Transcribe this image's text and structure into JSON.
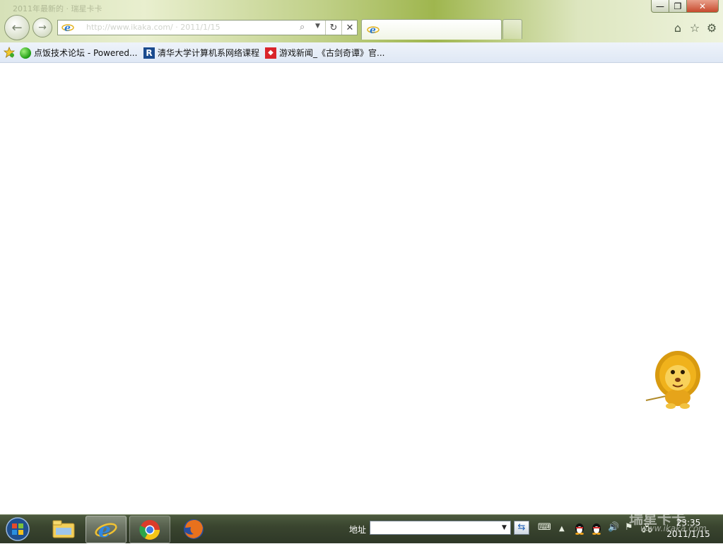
{
  "window": {
    "ghost_title": "2011年最新的 · 瑞星卡卡"
  },
  "window_controls": {
    "minimize": "—",
    "maximize": "❐",
    "close": "✕"
  },
  "nav": {
    "back_glyph": "←",
    "forward_glyph": "→"
  },
  "address_bar": {
    "ghost_url": "http://www.ikaka.com/ · 2011/1/15",
    "search_glyph": "⌕",
    "dropdown_glyph": "▼",
    "refresh_glyph": "↻",
    "stop_glyph": "✕"
  },
  "tabs": {
    "active_title": ""
  },
  "toolbar_icons": {
    "home": "⌂",
    "favorites": "☆",
    "tools": "⚙"
  },
  "favorites_bar": {
    "items": [
      {
        "label": "点饭技术论坛 - Powered...",
        "icon": "green-circle-icon"
      },
      {
        "label": "清华大学计算机系网络课程",
        "icon": "r-logo-icon",
        "icon_text": "R"
      },
      {
        "label": "游戏新闻_《古剑奇谭》官...",
        "icon": "game-logo-icon",
        "icon_text": "◆"
      }
    ]
  },
  "taskbar": {
    "address_label": "地址",
    "address_value": "",
    "dropdown_glyph": "▼",
    "go_glyph": "⇆",
    "tray": {
      "keyboard": "⌨",
      "expand": "▲",
      "volume": "🔊",
      "flag": "⚑",
      "network": "🖧"
    },
    "clock_time": "23:35",
    "clock_date": "2011/1/15"
  },
  "watermark": {
    "text": "瑞星卡卡",
    "url": "www.ikaka.com"
  },
  "colors": {
    "chrome_green": "#9fb64e",
    "taskbar": "#3a452f",
    "favbar": "#e6edf7"
  }
}
